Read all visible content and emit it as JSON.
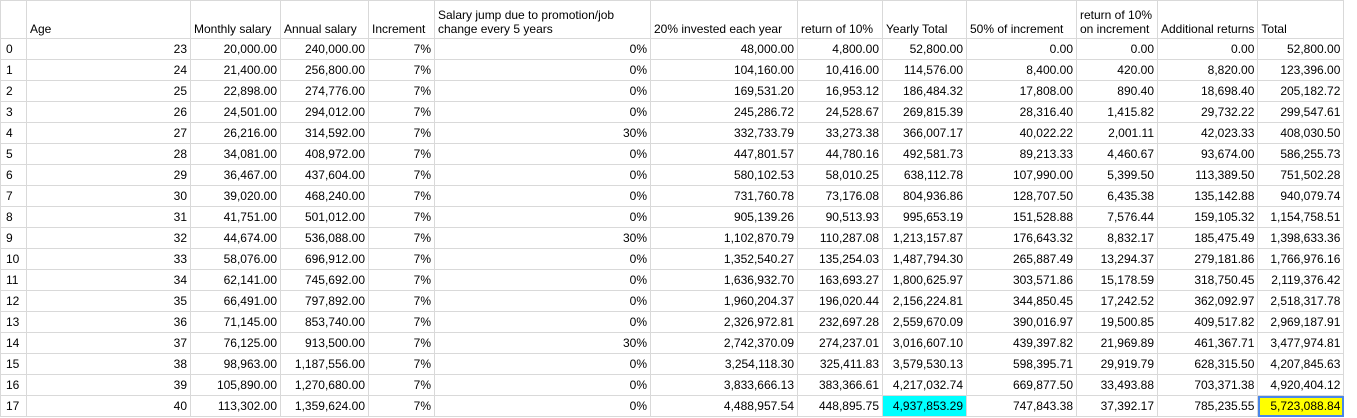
{
  "headers": [
    "",
    "Age",
    "Monthly salary",
    "Annual salary",
    "Increment",
    "Salary jump due to promotion/job change every 5 years",
    "20% invested each year",
    "return of 10%",
    "Yearly Total",
    "50% of increment",
    "return of 10% on increment",
    "Additional returns",
    "Total"
  ],
  "rows": [
    [
      "0",
      "23",
      "20,000.00",
      "240,000.00",
      "7%",
      "0%",
      "48,000.00",
      "4,800.00",
      "52,800.00",
      "0.00",
      "0.00",
      "0.00",
      "52,800.00"
    ],
    [
      "1",
      "24",
      "21,400.00",
      "256,800.00",
      "7%",
      "0%",
      "104,160.00",
      "10,416.00",
      "114,576.00",
      "8,400.00",
      "420.00",
      "8,820.00",
      "123,396.00"
    ],
    [
      "2",
      "25",
      "22,898.00",
      "274,776.00",
      "7%",
      "0%",
      "169,531.20",
      "16,953.12",
      "186,484.32",
      "17,808.00",
      "890.40",
      "18,698.40",
      "205,182.72"
    ],
    [
      "3",
      "26",
      "24,501.00",
      "294,012.00",
      "7%",
      "0%",
      "245,286.72",
      "24,528.67",
      "269,815.39",
      "28,316.40",
      "1,415.82",
      "29,732.22",
      "299,547.61"
    ],
    [
      "4",
      "27",
      "26,216.00",
      "314,592.00",
      "7%",
      "30%",
      "332,733.79",
      "33,273.38",
      "366,007.17",
      "40,022.22",
      "2,001.11",
      "42,023.33",
      "408,030.50"
    ],
    [
      "5",
      "28",
      "34,081.00",
      "408,972.00",
      "7%",
      "0%",
      "447,801.57",
      "44,780.16",
      "492,581.73",
      "89,213.33",
      "4,460.67",
      "93,674.00",
      "586,255.73"
    ],
    [
      "6",
      "29",
      "36,467.00",
      "437,604.00",
      "7%",
      "0%",
      "580,102.53",
      "58,010.25",
      "638,112.78",
      "107,990.00",
      "5,399.50",
      "113,389.50",
      "751,502.28"
    ],
    [
      "7",
      "30",
      "39,020.00",
      "468,240.00",
      "7%",
      "0%",
      "731,760.78",
      "73,176.08",
      "804,936.86",
      "128,707.50",
      "6,435.38",
      "135,142.88",
      "940,079.74"
    ],
    [
      "8",
      "31",
      "41,751.00",
      "501,012.00",
      "7%",
      "0%",
      "905,139.26",
      "90,513.93",
      "995,653.19",
      "151,528.88",
      "7,576.44",
      "159,105.32",
      "1,154,758.51"
    ],
    [
      "9",
      "32",
      "44,674.00",
      "536,088.00",
      "7%",
      "30%",
      "1,102,870.79",
      "110,287.08",
      "1,213,157.87",
      "176,643.32",
      "8,832.17",
      "185,475.49",
      "1,398,633.36"
    ],
    [
      "10",
      "33",
      "58,076.00",
      "696,912.00",
      "7%",
      "0%",
      "1,352,540.27",
      "135,254.03",
      "1,487,794.30",
      "265,887.49",
      "13,294.37",
      "279,181.86",
      "1,766,976.16"
    ],
    [
      "11",
      "34",
      "62,141.00",
      "745,692.00",
      "7%",
      "0%",
      "1,636,932.70",
      "163,693.27",
      "1,800,625.97",
      "303,571.86",
      "15,178.59",
      "318,750.45",
      "2,119,376.42"
    ],
    [
      "12",
      "35",
      "66,491.00",
      "797,892.00",
      "7%",
      "0%",
      "1,960,204.37",
      "196,020.44",
      "2,156,224.81",
      "344,850.45",
      "17,242.52",
      "362,092.97",
      "2,518,317.78"
    ],
    [
      "13",
      "36",
      "71,145.00",
      "853,740.00",
      "7%",
      "0%",
      "2,326,972.81",
      "232,697.28",
      "2,559,670.09",
      "390,016.97",
      "19,500.85",
      "409,517.82",
      "2,969,187.91"
    ],
    [
      "14",
      "37",
      "76,125.00",
      "913,500.00",
      "7%",
      "30%",
      "2,742,370.09",
      "274,237.01",
      "3,016,607.10",
      "439,397.82",
      "21,969.89",
      "461,367.71",
      "3,477,974.81"
    ],
    [
      "15",
      "38",
      "98,963.00",
      "1,187,556.00",
      "7%",
      "0%",
      "3,254,118.30",
      "325,411.83",
      "3,579,530.13",
      "598,395.71",
      "29,919.79",
      "628,315.50",
      "4,207,845.63"
    ],
    [
      "16",
      "39",
      "105,890.00",
      "1,270,680.00",
      "7%",
      "0%",
      "3,833,666.13",
      "383,366.61",
      "4,217,032.74",
      "669,877.50",
      "33,493.88",
      "703,371.38",
      "4,920,404.12"
    ],
    [
      "17",
      "40",
      "113,302.00",
      "1,359,624.00",
      "7%",
      "0%",
      "4,488,957.54",
      "448,895.75",
      "4,937,853.29",
      "747,843.38",
      "37,392.17",
      "785,235.55",
      "5,723,088.84"
    ]
  ],
  "highlights": {
    "cyan": "#00ffff",
    "yellow": "#ffff00",
    "selection": "#4a86e8"
  }
}
